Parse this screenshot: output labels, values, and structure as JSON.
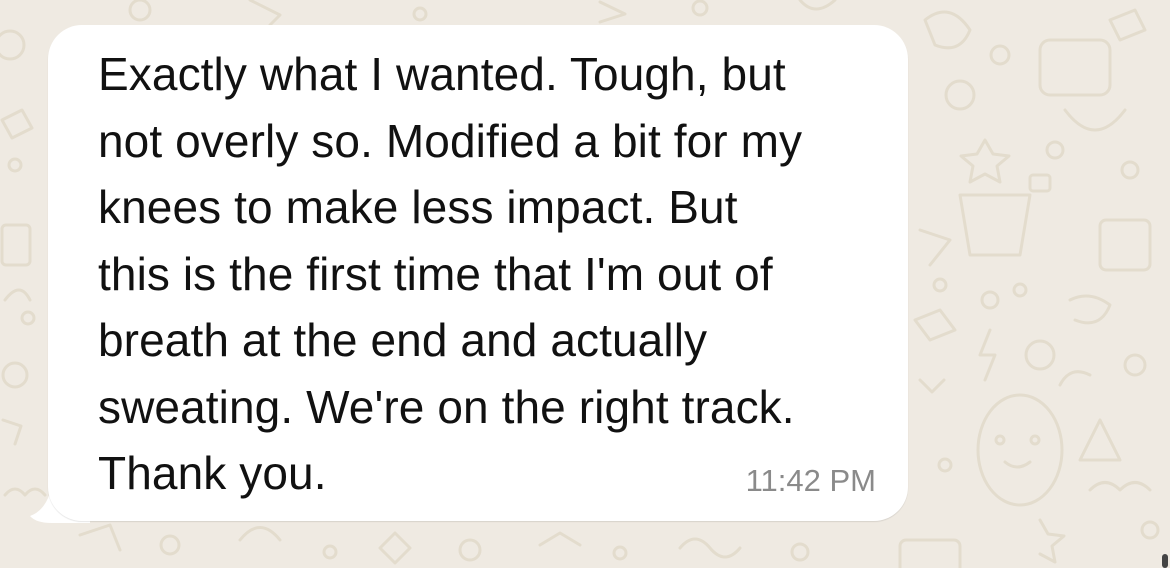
{
  "chat": {
    "background_color": "#efeae2",
    "doodle_color": "#e3dccd",
    "message": {
      "text": "Exactly what I wanted. Tough, but\nnot overly so. Modified a bit for my\nknees to make less impact. But\nthis is the first time that I'm out of\nbreath at the end and actually\nsweating. We're on the right track.\nThank you.",
      "time": "11:42 PM",
      "bubble_color": "#ffffff",
      "direction": "incoming"
    }
  }
}
